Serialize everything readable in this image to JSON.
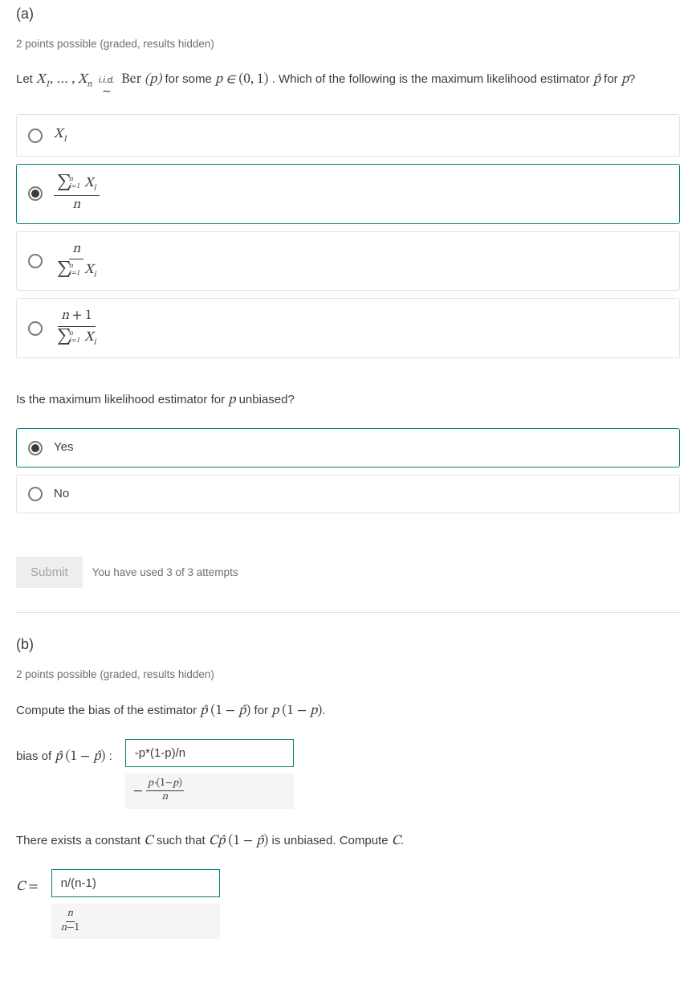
{
  "partA": {
    "label": "(a)",
    "points": "2 points possible (graded, results hidden)",
    "q1_pre": "Let ",
    "q1_mid": " for some ",
    "q1_post": ". Which of the following is the maximum likelihood estimator ",
    "q1_end": " for ",
    "q1_final": "?",
    "q2_pre": "Is the maximum likelihood estimator for ",
    "q2_post": " unbiased?",
    "options2": {
      "yes": "Yes",
      "no": "No"
    },
    "selected_opt1": 1,
    "selected_opt2": 0,
    "submit": "Submit",
    "attempts": "You have used 3 of 3 attempts"
  },
  "partB": {
    "label": "(b)",
    "points": "2 points possible (graded, results hidden)",
    "q1_pre": "Compute the bias of the estimator ",
    "q1_mid": " for ",
    "q1_end": ".",
    "label_bias_pre": "bias of ",
    "label_bias_post": " :",
    "input_bias": "-p*(1-p)/n",
    "q2_pre": "There exists a constant ",
    "q2_mid": " such that ",
    "q2_post": " is unbiased. Compute ",
    "q2_end": ".",
    "label_C": "C =",
    "input_C": "n/(n-1)"
  }
}
